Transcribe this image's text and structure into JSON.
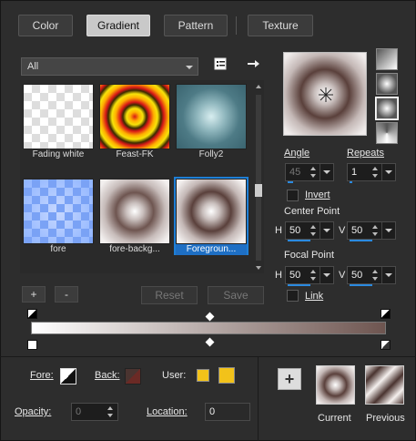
{
  "tabs": [
    {
      "label": "Color"
    },
    {
      "label": "Gradient"
    },
    {
      "label": "Pattern"
    },
    {
      "label": "Texture"
    }
  ],
  "library": {
    "category": "All",
    "items": [
      {
        "name": "Fading white"
      },
      {
        "name": "Feast-FK"
      },
      {
        "name": "Folly2"
      },
      {
        "name": "fore"
      },
      {
        "name": "fore-backg..."
      },
      {
        "name": "Foregroun..."
      }
    ]
  },
  "library_buttons": {
    "add": "+",
    "remove": "-",
    "reset": "Reset",
    "save": "Save"
  },
  "angle": {
    "label": "Angle",
    "value": "45"
  },
  "repeats": {
    "label": "Repeats",
    "value": "1"
  },
  "invert": {
    "label": "Invert"
  },
  "center_point": {
    "label": "Center Point",
    "h_label": "H",
    "h_value": "50",
    "v_label": "V",
    "v_value": "50"
  },
  "focal_point": {
    "label": "Focal Point",
    "h_label": "H",
    "h_value": "50",
    "v_label": "V",
    "v_value": "50"
  },
  "link": {
    "label": "Link"
  },
  "bottom": {
    "fore_label": "Fore:",
    "back_label": "Back:",
    "user_label": "User:",
    "opacity_label": "Opacity:",
    "opacity_value": "0",
    "location_label": "Location:",
    "location_value": "0",
    "add_button": "+",
    "current_label": "Current",
    "previous_label": "Previous"
  },
  "colors": {
    "accent": "#1e7fd6",
    "user_color": "#f2c21a",
    "gradient_dark": "#4a3430",
    "gradient_light": "#ffffff"
  }
}
